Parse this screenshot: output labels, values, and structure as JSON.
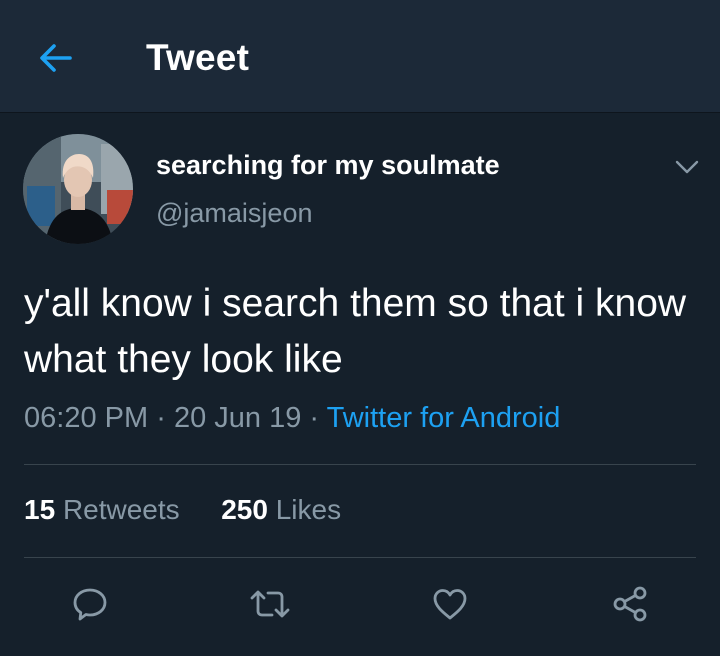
{
  "header": {
    "title": "Tweet",
    "back_icon": "arrow-left-icon"
  },
  "tweet": {
    "display_name": "searching for my soulmate",
    "handle": "@jamaisjeon",
    "text": "y'all know i search them so that i know what they look like",
    "time": "06:20 PM",
    "date": "20 Jun 19",
    "separator": "·",
    "source": "Twitter for Android",
    "retweets": {
      "count": "15",
      "label": "Retweets"
    },
    "likes": {
      "count": "250",
      "label": "Likes"
    }
  },
  "actions": [
    "reply-icon",
    "retweet-icon",
    "like-icon",
    "share-icon"
  ],
  "colors": {
    "background": "#15202b",
    "header": "#1c2938",
    "accent": "#1da1f2",
    "secondary_text": "#8899a6",
    "divider": "#38444d"
  }
}
